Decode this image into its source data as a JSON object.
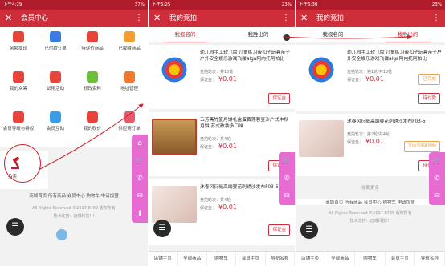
{
  "panel1": {
    "status": {
      "time": "下午4:29",
      "right": "37%"
    },
    "title": "会员中心",
    "back": "✕",
    "more": "⋮",
    "grid": [
      {
        "label": "余额提现",
        "icon": "wallet-icon",
        "color": "#e8443a"
      },
      {
        "label": "已付款订单",
        "icon": "order-icon",
        "color": "#3a7be8"
      },
      {
        "label": "待评价商品",
        "icon": "comment-icon",
        "color": "#e8443a"
      },
      {
        "label": "已收藏商品",
        "icon": "star-icon",
        "color": "#f0a030"
      },
      {
        "label": "我的众筹",
        "icon": "crowdfund-icon",
        "color": "#e8443a"
      },
      {
        "label": "试用活动",
        "icon": "trial-icon",
        "color": "#e8443a"
      },
      {
        "label": "修改资料",
        "icon": "edit-icon",
        "color": "#6bbf3a"
      },
      {
        "label": "地址管理",
        "icon": "location-icon",
        "color": "#f07a30"
      },
      {
        "label": "会员等级与特权",
        "icon": "vip-icon",
        "color": "#e8443a"
      },
      {
        "label": "会员互动",
        "icon": "chat-icon",
        "color": "#3a9be8"
      },
      {
        "label": "我的砍价",
        "icon": "bargain-icon",
        "color": "#e8443a"
      },
      {
        "label": "供应商订单",
        "icon": "supplier-icon",
        "color": "#e85a6a"
      }
    ],
    "auction_label": "拍卖",
    "footer_links": "商城首页  所有商品  会员中心  购物车  申请加盟",
    "copyright": "All Rights Reserved ©2017 8769 版权所有",
    "support": "技术支持：迈博科技!!!"
  },
  "panel2": {
    "status": {
      "time": "下午6:25",
      "right": "23%"
    },
    "title": "我的竞拍",
    "back": "✕",
    "more": "⋮",
    "tabs": [
      "我报名的",
      "我胜出的"
    ],
    "items": [
      {
        "name": "幼儿园手工软飞盘 儿童练习带扣子玩具亲子户外安全娱乐游戏飞碟alga阿内托阿帕比",
        "round": "竞拍轮次：共10轮",
        "deposit": "保证金：",
        "price": "¥0.01",
        "button": "保证金"
      },
      {
        "name": "五芳斋竹篮月饼礼盒蛋黄莲蓉豆沙广式中秋月饼 苏式散装多口味",
        "round": "竞拍轮次：共4轮",
        "deposit": "保证金：",
        "price": "¥0.01",
        "button": "保证金"
      },
      {
        "name": "沐春风衍缝高端婴花刺绣沙发布F03-5",
        "round": "竞拍轮次：共4轮",
        "deposit": "保证金：",
        "price": "¥0.01",
        "button": "保证金"
      }
    ],
    "bottom_nav": [
      "店铺主页",
      "全部商品",
      "购物车",
      "会员主页",
      "导航名称"
    ]
  },
  "panel3": {
    "status": {
      "time": "下午6:30",
      "right": "23%"
    },
    "title": "我的竞拍",
    "back": "✕",
    "more": "⋮",
    "tabs": [
      "我报名的",
      "我胜出的"
    ],
    "items": [
      {
        "name": "幼儿园手工软飞盘 儿童练习带扣子玩具亲子户外安全娱乐游戏飞碟alga阿内托阿帕比",
        "round": "竞拍轮次：第1轮/共10轮",
        "deposit": "保证金：",
        "price": "¥0.01",
        "status_btn": "已完成",
        "action_btn": "待付款"
      },
      {
        "name": "沐春风衍缝高端婴花刺绣沙发布F03-5",
        "round": "竞拍轮次：第2轮/共4轮",
        "deposit": "保证金：",
        "price": "¥0.01",
        "status_btn": "活动(到期兼付款)",
        "action_btn": "待付款"
      }
    ],
    "load_more": "加载更多",
    "footer_links": "商城首页  所有商品  会员中心  购物车  申请加盟",
    "copyright": "All Rights Reserved ©2017 8769 版权所有",
    "support": "技术支持：迈博科技!!!",
    "bottom_nav": [
      "店铺主页",
      "全部商品",
      "购物车",
      "会员主页",
      "导航名称"
    ]
  },
  "colors": {
    "brand": "#cd2e3a",
    "sidebar": "#e86bd4",
    "arrow": "#d0202a"
  }
}
